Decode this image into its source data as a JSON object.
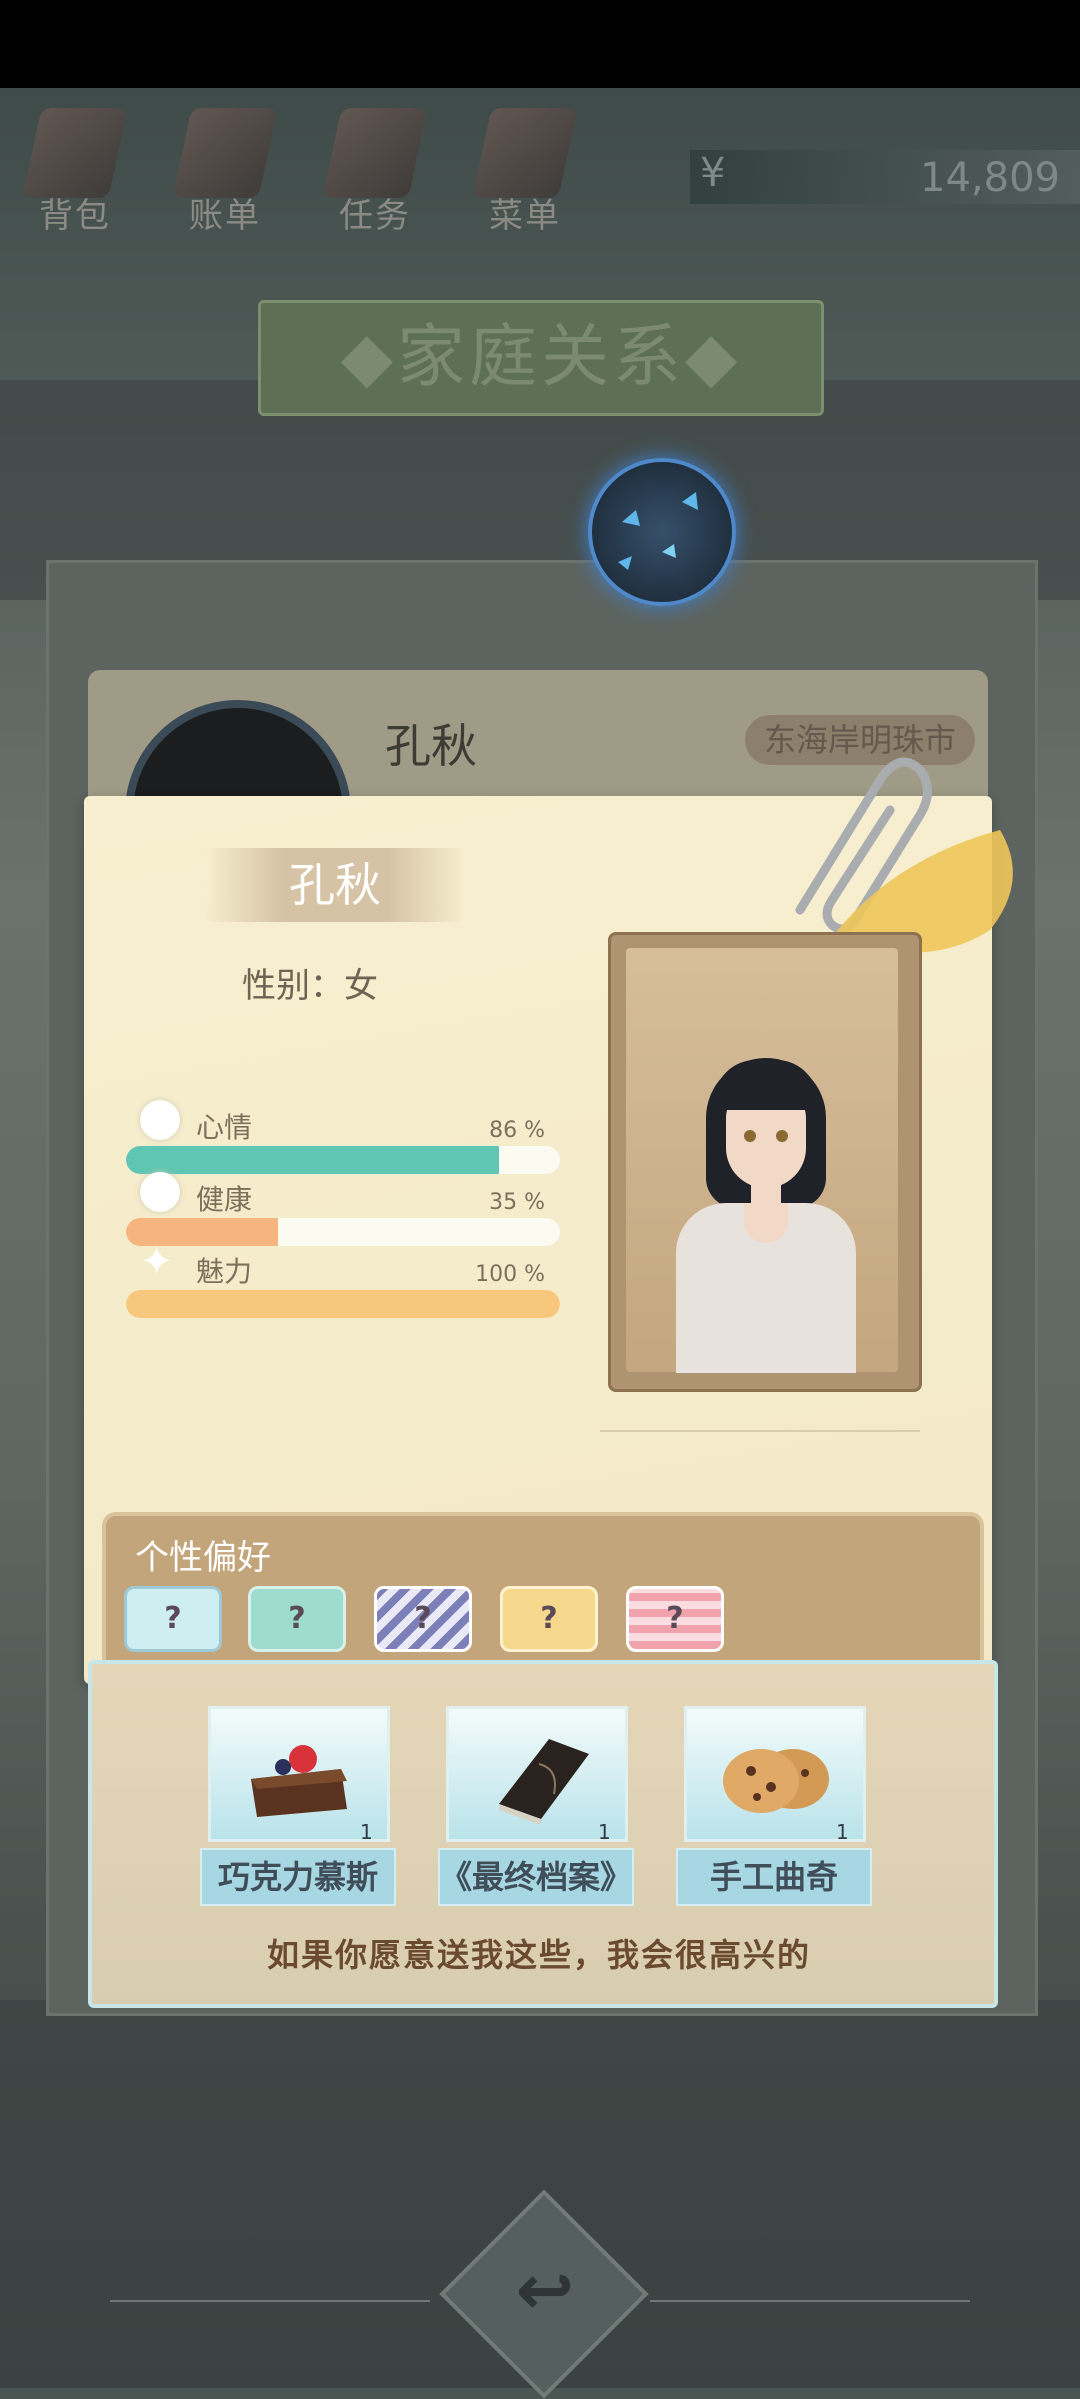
{
  "nav": {
    "bag": "背包",
    "bill": "账单",
    "task": "任务",
    "menu": "菜单"
  },
  "money": {
    "symbol": "¥",
    "value": "14,809"
  },
  "title": "◆家庭关系◆",
  "back_card": {
    "name": "孔秋",
    "location": "东海岸明珠市"
  },
  "profile": {
    "name": "孔秋",
    "gender": "性别：女",
    "stats": [
      {
        "label": "心情",
        "percent_text": "86 %",
        "value": 0.86,
        "color": "#5fc6b3"
      },
      {
        "label": "健康",
        "percent_text": "35 %",
        "value": 0.35,
        "color": "#f6b47f"
      },
      {
        "label": "魅力",
        "percent_text": "100 %",
        "value": 1.0,
        "color": "#f7c77e"
      }
    ]
  },
  "preferences": {
    "title": "个性偏好",
    "items": [
      "?",
      "?",
      "?",
      "?",
      "?"
    ]
  },
  "gifts": [
    {
      "name": "巧克力慕斯",
      "qty": "1"
    },
    {
      "name": "《最终档案》",
      "qty": "1"
    },
    {
      "name": "手工曲奇",
      "qty": "1"
    }
  ],
  "gift_message": "如果你愿意送我这些，我会很高兴的",
  "icons": {
    "back": "return-arrow-icon"
  }
}
